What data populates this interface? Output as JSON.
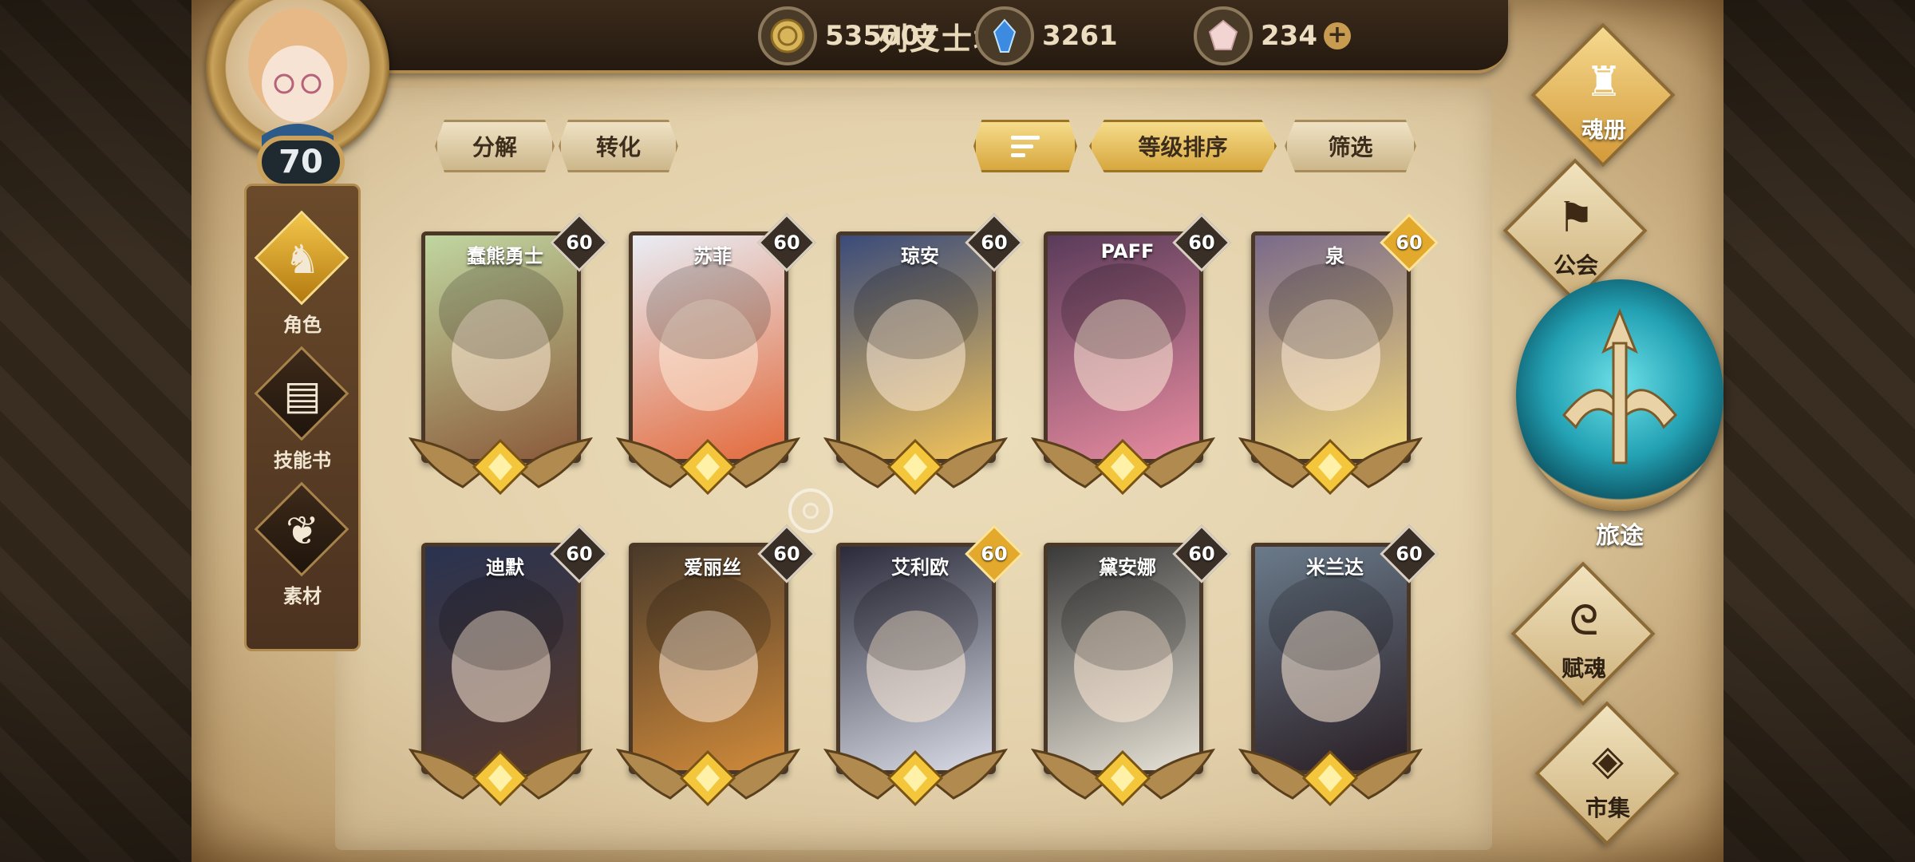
{
  "player": {
    "name": "列支士墩",
    "level": "70"
  },
  "currencies": [
    {
      "icon": "gold-coin-icon",
      "value": "535007"
    },
    {
      "icon": "blue-crystal-icon",
      "value": "3261"
    },
    {
      "icon": "pink-gem-icon",
      "value": "234",
      "plus": "+"
    }
  ],
  "left_tabs": [
    {
      "label": "角色",
      "icon": "character-icon",
      "active": true
    },
    {
      "label": "技能书",
      "icon": "skill-book-icon",
      "active": false
    },
    {
      "label": "素材",
      "icon": "material-icon",
      "active": false
    }
  ],
  "actions": {
    "decompose": "分解",
    "convert": "转化",
    "sort_by_level": "等级排序",
    "filter": "筛选"
  },
  "cards": [
    {
      "name": "蠢熊勇士",
      "level": "60",
      "gold": false,
      "colors": [
        "#c0d6a0",
        "#8b5a3a"
      ]
    },
    {
      "name": "苏菲",
      "level": "60",
      "gold": false,
      "colors": [
        "#e8edf5",
        "#e36a3c"
      ]
    },
    {
      "name": "琼安",
      "level": "60",
      "gold": false,
      "colors": [
        "#3a4b7a",
        "#f2c35a"
      ]
    },
    {
      "name": "PAFF",
      "level": "60",
      "gold": false,
      "colors": [
        "#5a3b5a",
        "#e88ca0"
      ]
    },
    {
      "name": "泉",
      "level": "60",
      "gold": true,
      "colors": [
        "#7a6a8a",
        "#f3d77a"
      ]
    },
    {
      "name": "迪默",
      "level": "60",
      "gold": false,
      "colors": [
        "#2a3350",
        "#5a3a2a"
      ]
    },
    {
      "name": "爱丽丝",
      "level": "60",
      "gold": false,
      "colors": [
        "#4a3a2a",
        "#d08a3a"
      ]
    },
    {
      "name": "艾利欧",
      "level": "60",
      "gold": true,
      "colors": [
        "#2a2a3a",
        "#d9dce6"
      ]
    },
    {
      "name": "黛安娜",
      "level": "60",
      "gold": false,
      "colors": [
        "#3a3a3a",
        "#e7e2d6"
      ]
    },
    {
      "name": "米兰达",
      "level": "60",
      "gold": false,
      "colors": [
        "#6a7a8a",
        "#2a1e24"
      ]
    }
  ],
  "right_nav": [
    {
      "label": "魂册",
      "icon": "soul-book-icon",
      "active": true
    },
    {
      "label": "公会",
      "icon": "guild-icon",
      "active": false
    },
    {
      "label": "旅途",
      "icon": "journey-icon",
      "active": false
    },
    {
      "label": "赋魂",
      "icon": "soul-infuse-icon",
      "active": false
    },
    {
      "label": "市集",
      "icon": "market-icon",
      "active": false
    }
  ]
}
